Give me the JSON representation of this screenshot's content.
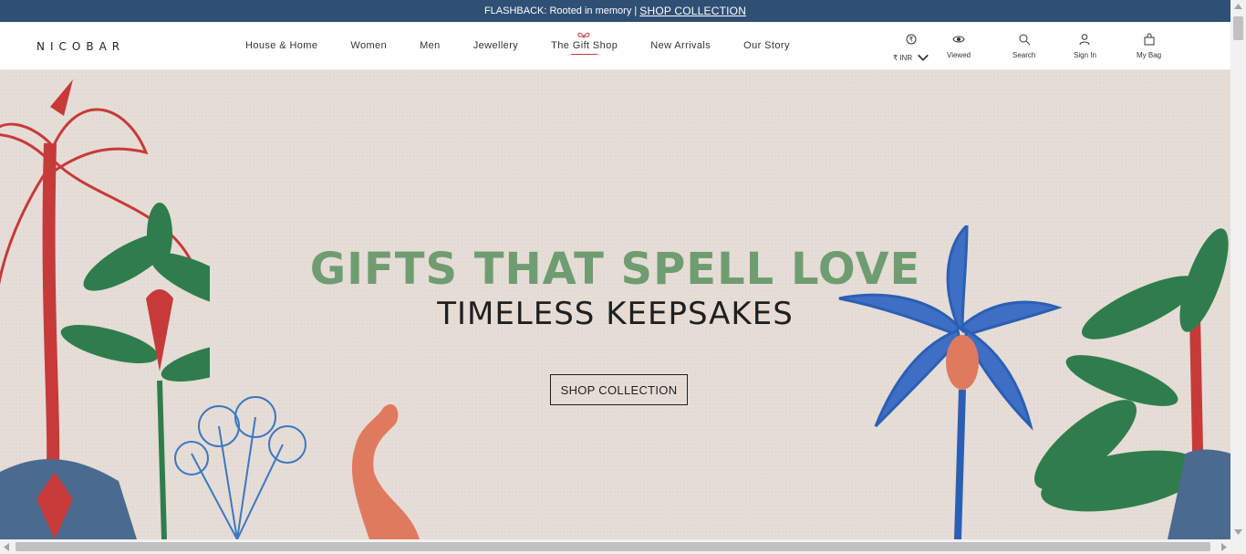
{
  "announcement": {
    "text": "FLASHBACK: Rooted in memory |",
    "link": "SHOP COLLECTION"
  },
  "header": {
    "logo": "NICOBAR",
    "nav": [
      "House & Home",
      "Women",
      "Men",
      "Jewellery",
      "The Gift Shop",
      "New Arrivals",
      "Our Story"
    ],
    "tools": {
      "currency": "₹ INR",
      "viewed": "Viewed",
      "search": "Search",
      "signin": "Sign In",
      "bag": "My Bag"
    }
  },
  "hero": {
    "title": "GIFTS THAT SPELL LOVE",
    "subtitle": "TIMELESS KEEPSAKES",
    "cta": "SHOP COLLECTION"
  },
  "colors": {
    "topbar": "#2f4f74",
    "hero_bg": "#e6ddd7",
    "title_green": "#6f9c71",
    "gift_red": "#c73a3a"
  },
  "icons": [
    "currency-icon",
    "eye-icon",
    "search-icon",
    "user-icon",
    "bag-icon",
    "chevron-down-icon"
  ]
}
